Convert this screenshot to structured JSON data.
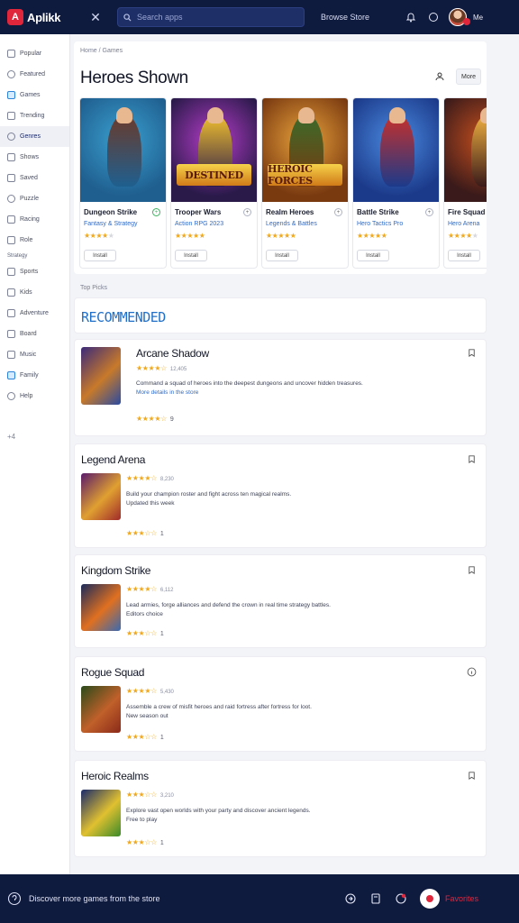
{
  "app": {
    "name": "Aplikk",
    "logo_letter": "A"
  },
  "topbar": {
    "search_placeholder": "Search apps",
    "link": "Browse Store",
    "user_name": "Me"
  },
  "sidebar": {
    "items": [
      {
        "label": "Popular",
        "active": false
      },
      {
        "label": "Featured",
        "active": false
      },
      {
        "label": "Games",
        "active": false,
        "accent": true
      },
      {
        "label": "Trending",
        "active": false
      },
      {
        "label": "Genres",
        "active": true
      },
      {
        "label": "Shows",
        "active": false
      },
      {
        "label": "Saved",
        "active": false
      },
      {
        "label": "Puzzle",
        "active": false
      },
      {
        "label": "Racing",
        "active": false
      },
      {
        "label": "Role",
        "active": false
      }
    ],
    "sub_label": "Strategy",
    "items2": [
      {
        "label": "Sports"
      },
      {
        "label": "Kids"
      },
      {
        "label": "Adventure"
      },
      {
        "label": "Board"
      },
      {
        "label": "Music"
      },
      {
        "label": "Family",
        "accent": true
      },
      {
        "label": "Help"
      }
    ],
    "more": "+4"
  },
  "header": {
    "breadcrumb": "Home / Games",
    "title": "Heroes Shown",
    "action_label": "More"
  },
  "featured": [
    {
      "title": "Dungeon Strike",
      "sub": "Fantasy & Strategy",
      "rating": 4.0,
      "button": "Install",
      "badge": "+",
      "badge_green": true,
      "banner": "",
      "palette": [
        "#1f5f8f",
        "#3aa0d0",
        "#6b3a2a"
      ]
    },
    {
      "title": "Trooper Wars",
      "sub": "Action RPG 2023",
      "rating": 4.5,
      "button": "Install",
      "badge": "+",
      "badge_green": false,
      "banner": "DESTINED",
      "palette": [
        "#2a1a4a",
        "#b43cc8",
        "#f2c12e"
      ]
    },
    {
      "title": "Realm Heroes",
      "sub": "Legends & Battles",
      "rating": 4.5,
      "button": "Install",
      "badge": "+",
      "badge_green": false,
      "banner": "HEROIC FORCES",
      "palette": [
        "#7a3a10",
        "#e9a23b",
        "#3a6b2a"
      ]
    },
    {
      "title": "Battle Strike",
      "sub": "Hero Tactics Pro",
      "rating": 4.5,
      "button": "Install",
      "badge": "+",
      "badge_green": false,
      "banner": "",
      "palette": [
        "#1c3a8a",
        "#4a8ae0",
        "#c8302a"
      ]
    },
    {
      "title": "Fire Squad",
      "sub": "Hero Arena",
      "rating": 4.0,
      "button": "Install",
      "badge": "+",
      "badge_green": false,
      "banner": "",
      "palette": [
        "#3a1a1a",
        "#c8501e",
        "#f0b040"
      ]
    }
  ],
  "section": {
    "breadcrumb": "Top Picks",
    "title": "RECOMMENDED"
  },
  "list": [
    {
      "title": "Arcane Shadow",
      "rating": 4.0,
      "count": "12,405",
      "desc": "Command a squad of heroes into the deepest dungeons and uncover hidden treasures.",
      "link": "More details in the store",
      "foot_rating": 4.0,
      "foot_count": "9",
      "palette": [
        "#3b2a7a",
        "#c87a2a",
        "#2a4aa0"
      ]
    },
    {
      "title": "Legend Arena",
      "rating": 4.0,
      "count": "8,230",
      "desc": "Build your champion roster and fight across ten magical realms.",
      "link": "",
      "extra": "Updated this week",
      "foot_rating": 3.0,
      "foot_count": "1",
      "palette": [
        "#5a1a6a",
        "#e0a030",
        "#a02a2a"
      ]
    },
    {
      "title": "Kingdom Strike",
      "rating": 4.0,
      "count": "6,112",
      "desc": "Lead armies, forge alliances and defend the crown in real time strategy battles.",
      "link": "",
      "extra": "Editors choice",
      "foot_rating": 3.0,
      "foot_count": "1",
      "palette": [
        "#1a2a5a",
        "#e07020",
        "#3a6ab0"
      ]
    },
    {
      "title": "Rogue Squad",
      "rating": 4.0,
      "count": "5,430",
      "desc": "Assemble a crew of misfit heroes and raid fortress after fortress for loot.",
      "link": "",
      "extra": "New season out",
      "foot_rating": 3.0,
      "foot_count": "1",
      "palette": [
        "#2a4a1a",
        "#c0602a",
        "#8a2a1a"
      ]
    },
    {
      "title": "Heroic Realms",
      "rating": 3.0,
      "count": "3,210",
      "desc": "Explore vast open worlds with your party and discover ancient legends.",
      "link": "",
      "extra": "Free to play",
      "foot_rating": 3.0,
      "foot_count": "1",
      "palette": [
        "#1a2a6a",
        "#e0c030",
        "#3a8a2a"
      ]
    }
  ],
  "bottombar": {
    "text": "Discover more games from the store",
    "label": "Favorites"
  }
}
